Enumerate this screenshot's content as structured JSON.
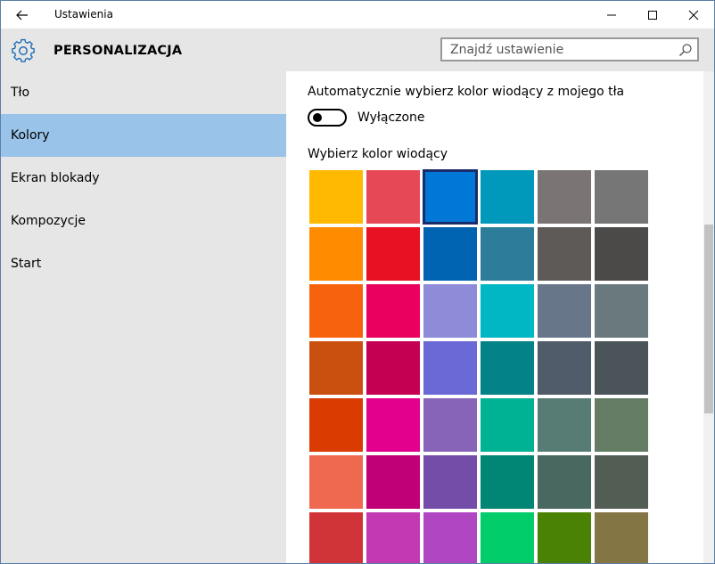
{
  "window": {
    "title": "Ustawienia"
  },
  "icons": {
    "back": "arrow-left-icon",
    "minimize": "minimize-icon",
    "maximize": "maximize-icon",
    "close": "close-icon",
    "settings": "gear-icon",
    "search": "search-icon"
  },
  "header": {
    "section_title": "PERSONALIZACJA",
    "search_placeholder": "Znajdź ustawienie",
    "accent_color": "#1f6fb5"
  },
  "sidebar": {
    "items": [
      {
        "label": "Tło",
        "active": false
      },
      {
        "label": "Kolory",
        "active": true
      },
      {
        "label": "Ekran blokady",
        "active": false
      },
      {
        "label": "Kompozycje",
        "active": false
      },
      {
        "label": "Start",
        "active": false
      }
    ],
    "active_color": "#99c3e8"
  },
  "content": {
    "auto_accent_label": "Automatycznie wybierz kolor wiodący z mojego tła",
    "auto_accent_state": "Wyłączone",
    "auto_accent_on": false,
    "pick_label": "Wybierz kolor wiodący",
    "selected_color": "#0078d7",
    "swatch_rows": [
      [
        "#ffb900",
        "#e74856",
        "#0078d7",
        "#0099bc",
        "#7a7574",
        "#767676"
      ],
      [
        "#ff8c00",
        "#e81123",
        "#0063b1",
        "#2d7d9a",
        "#5d5a58",
        "#4c4a48"
      ],
      [
        "#f7630c",
        "#ea005e",
        "#8e8cd8",
        "#00b7c3",
        "#68768a",
        "#69797e"
      ],
      [
        "#ca5010",
        "#c30052",
        "#6b69d6",
        "#038387",
        "#515c6b",
        "#4a5459"
      ],
      [
        "#da3b01",
        "#e3008c",
        "#8764b8",
        "#00b294",
        "#567c73",
        "#647c64"
      ],
      [
        "#ef6950",
        "#bf0077",
        "#744da9",
        "#018574",
        "#486860",
        "#525e54"
      ],
      [
        "#d13438",
        "#c239b3",
        "#b146c2",
        "#00cc6a",
        "#498205",
        "#847545"
      ]
    ]
  }
}
